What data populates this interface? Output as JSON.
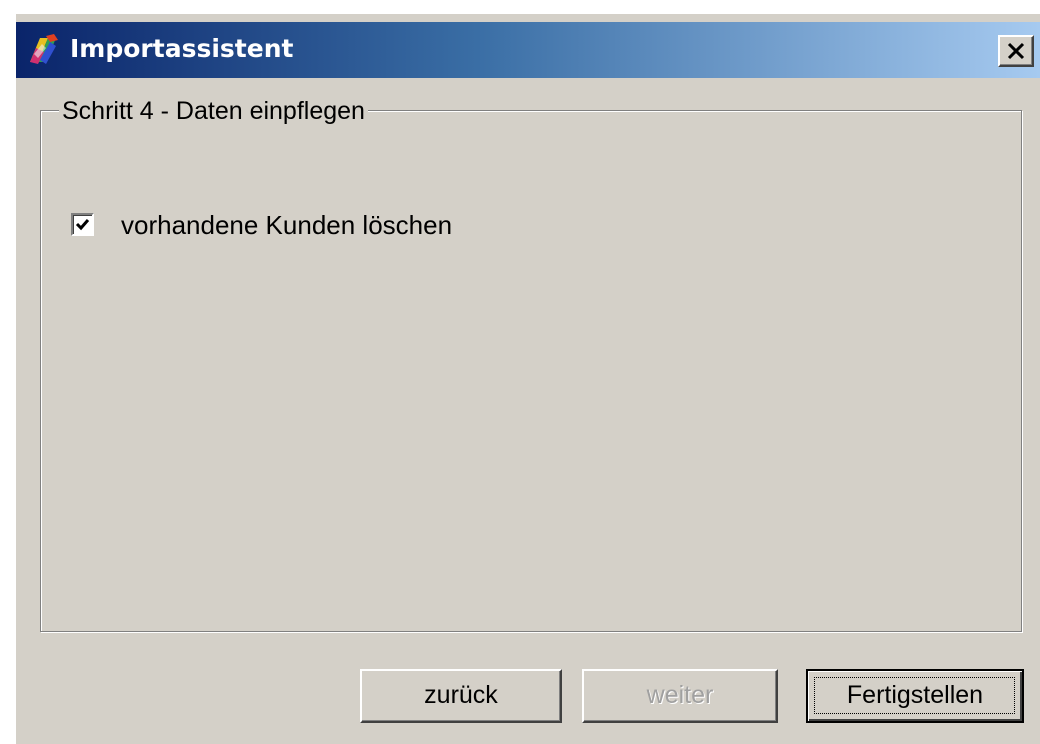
{
  "window": {
    "title": "Importassistent",
    "close_icon": "close-icon",
    "app_icon": "import-wizard-icon"
  },
  "step_group": {
    "title": "Schritt 4 - Daten einpflegen",
    "checkbox": {
      "label": "vorhandene Kunden löschen",
      "checked": true
    }
  },
  "buttons": {
    "back": "zurück",
    "next": "weiter",
    "finish": "Fertigstellen",
    "next_enabled": false
  },
  "colors": {
    "title_gradient_start": "#0a246a",
    "title_gradient_end": "#a6caf0",
    "dialog_face": "#d4d0c8"
  }
}
